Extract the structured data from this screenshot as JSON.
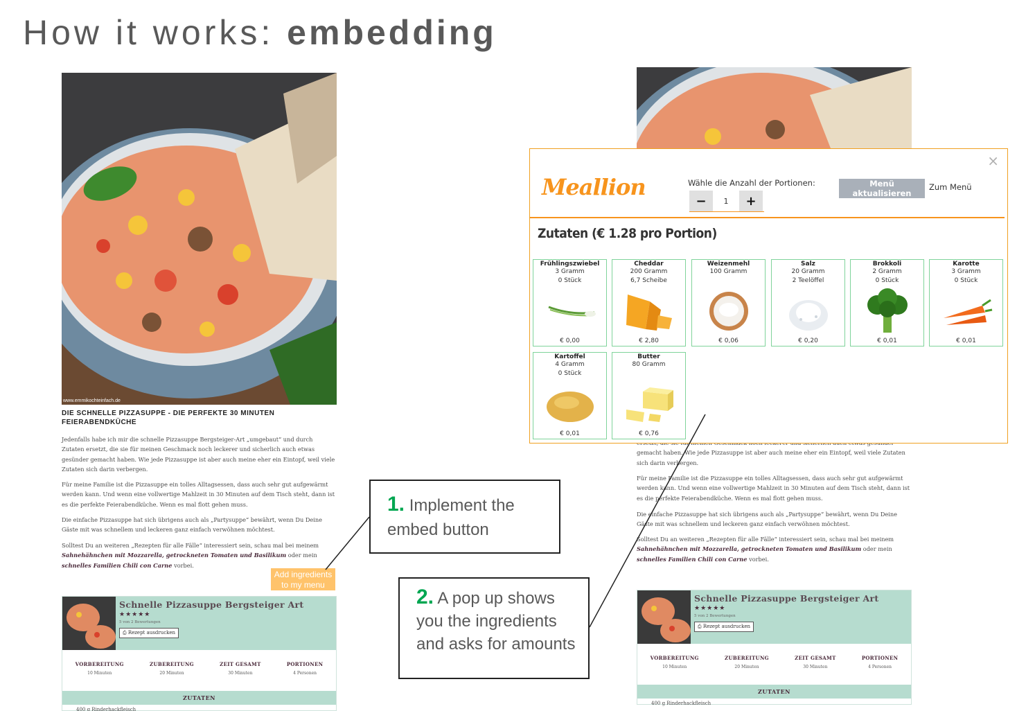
{
  "title": {
    "prefix": "How it works: ",
    "bold": "embedding"
  },
  "blog": {
    "credit": "www.emmikochteinfach.de",
    "post_title": "Die schnelle Pizzasuppe - Die perfekte 30 Minuten Feierabendküche",
    "p1": "Jedenfalls habe ich mir die schnelle Pizzasuppe Bergsteiger-Art „umgebaut“ und durch Zutaten ersetzt, die sie für meinen Geschmack noch leckerer und sicherlich auch etwas gesünder gemacht haben. Wie jede Pizzasuppe ist aber auch meine eher ein Eintopf, weil viele Zutaten sich darin verbergen.",
    "p1_cut": "ersetzt, die sie für meinen Geschmack noch leckerer und sicherlich auch etwas gesünder gemacht haben. Wie jede Pizzasuppe ist aber auch meine eher ein Eintopf, weil viele Zutaten sich darin verbergen.",
    "p2": "Für meine Familie ist die Pizzasuppe ein tolles Alltagsessen, dass auch sehr gut aufgewärmt werden kann. Und wenn eine vollwertige Mahlzeit in 30 Minuten auf dem Tisch steht, dann ist es die perfekte Feierabendküche. Wenn es mal flott gehen muss.",
    "p3": "Die einfache Pizzasuppe hat sich übrigens auch als „Partysuppe“ bewährt, wenn Du Deine Gäste mit was schnellem und leckeren ganz einfach verwöhnen möchtest.",
    "p4_a": "Solltest Du an weiteren „Rezepten für alle Fälle“ interessiert sein, schau mal bei meinem ",
    "p4_link1": "Sahnehähnchen mit Mozzarella, getrockneten Tomaten und Basilikum",
    "p4_b": " oder mein ",
    "p4_link2": "schnelles Familien Chili con Carne",
    "p4_c": " vorbei.",
    "embed_button": "Add ingredients to my menu",
    "recipe_card": {
      "title": "Schnelle Pizzasuppe Bergsteiger Art",
      "stars": "★★★★★",
      "votes": "5 von 2 Bewertungen",
      "print": "Rezept ausdrucken",
      "stats": [
        {
          "label": "VORBEREITUNG",
          "value": "10 Minuten"
        },
        {
          "label": "ZUBEREITUNG",
          "value": "20 Minuten"
        },
        {
          "label": "ZEIT GESAMT",
          "value": "30 Minuten"
        },
        {
          "label": "PORTIONEN",
          "value": "4 Personen"
        }
      ],
      "section": "ZUTATEN",
      "first_line": "400 g Rinderhackfleisch"
    }
  },
  "callouts": [
    {
      "num": "1.",
      "text": " Implement the embed button"
    },
    {
      "num": "2.",
      "text": " A pop up shows you the ingredients and asks for amounts"
    }
  ],
  "popup": {
    "logo": "Meallion",
    "portions_label": "Wähle die Anzahl der Portionen:",
    "minus": "−",
    "plus": "+",
    "portions": "1",
    "update_button": "Menü aktualisieren",
    "menu_link": "Zum Menü",
    "close": "×",
    "heading": "Zutaten (€ 1.28 pro Portion)",
    "ingredients": [
      {
        "name": "Frühlingszwiebel",
        "q1": "3 Gramm",
        "q2": "0 Stück",
        "price": "€ 0,00",
        "icon": "spring-onion-icon"
      },
      {
        "name": "Cheddar",
        "q1": "200 Gramm",
        "q2": "6,7 Scheibe",
        "price": "€ 2,80",
        "icon": "cheddar-icon"
      },
      {
        "name": "Weizenmehl",
        "q1": "100 Gramm",
        "q2": "",
        "price": "€ 0,06",
        "icon": "flour-icon"
      },
      {
        "name": "Salz",
        "q1": "20 Gramm",
        "q2": "2 Teelöffel",
        "price": "€ 0,20",
        "icon": "salt-icon"
      },
      {
        "name": "Brokkoli",
        "q1": "2 Gramm",
        "q2": "0 Stück",
        "price": "€ 0,01",
        "icon": "broccoli-icon"
      },
      {
        "name": "Karotte",
        "q1": "3 Gramm",
        "q2": "0 Stück",
        "price": "€ 0,01",
        "icon": "carrot-icon"
      },
      {
        "name": "Kartoffel",
        "q1": "4 Gramm",
        "q2": "0 Stück",
        "price": "€ 0,01",
        "icon": "potato-icon"
      },
      {
        "name": "Butter",
        "q1": "80 Gramm",
        "q2": "",
        "price": "€ 0,76",
        "icon": "butter-icon"
      }
    ]
  },
  "colors": {
    "accent": "#f7941d",
    "callout_number": "#00a651",
    "card_mint": "#b6dccf",
    "embed_button": "#ffc36b",
    "ingredient_border": "#7fd39a"
  }
}
